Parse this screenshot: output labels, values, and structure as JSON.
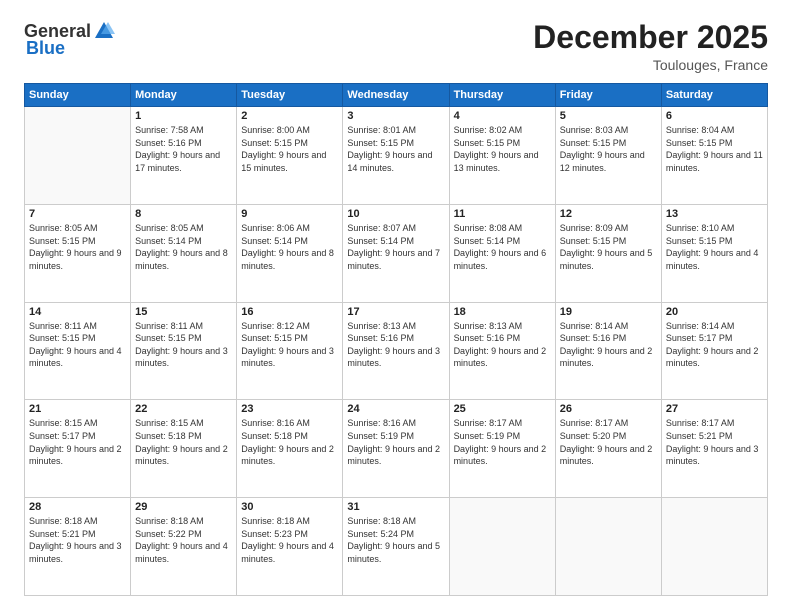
{
  "logo": {
    "general": "General",
    "blue": "Blue"
  },
  "title": "December 2025",
  "subtitle": "Toulouges, France",
  "days_header": [
    "Sunday",
    "Monday",
    "Tuesday",
    "Wednesday",
    "Thursday",
    "Friday",
    "Saturday"
  ],
  "weeks": [
    [
      {
        "day": "",
        "sunrise": "",
        "sunset": "",
        "daylight": ""
      },
      {
        "day": "1",
        "sunrise": "Sunrise: 7:58 AM",
        "sunset": "Sunset: 5:16 PM",
        "daylight": "Daylight: 9 hours and 17 minutes."
      },
      {
        "day": "2",
        "sunrise": "Sunrise: 8:00 AM",
        "sunset": "Sunset: 5:15 PM",
        "daylight": "Daylight: 9 hours and 15 minutes."
      },
      {
        "day": "3",
        "sunrise": "Sunrise: 8:01 AM",
        "sunset": "Sunset: 5:15 PM",
        "daylight": "Daylight: 9 hours and 14 minutes."
      },
      {
        "day": "4",
        "sunrise": "Sunrise: 8:02 AM",
        "sunset": "Sunset: 5:15 PM",
        "daylight": "Daylight: 9 hours and 13 minutes."
      },
      {
        "day": "5",
        "sunrise": "Sunrise: 8:03 AM",
        "sunset": "Sunset: 5:15 PM",
        "daylight": "Daylight: 9 hours and 12 minutes."
      },
      {
        "day": "6",
        "sunrise": "Sunrise: 8:04 AM",
        "sunset": "Sunset: 5:15 PM",
        "daylight": "Daylight: 9 hours and 11 minutes."
      }
    ],
    [
      {
        "day": "7",
        "sunrise": "Sunrise: 8:05 AM",
        "sunset": "Sunset: 5:15 PM",
        "daylight": "Daylight: 9 hours and 9 minutes."
      },
      {
        "day": "8",
        "sunrise": "Sunrise: 8:05 AM",
        "sunset": "Sunset: 5:14 PM",
        "daylight": "Daylight: 9 hours and 8 minutes."
      },
      {
        "day": "9",
        "sunrise": "Sunrise: 8:06 AM",
        "sunset": "Sunset: 5:14 PM",
        "daylight": "Daylight: 9 hours and 8 minutes."
      },
      {
        "day": "10",
        "sunrise": "Sunrise: 8:07 AM",
        "sunset": "Sunset: 5:14 PM",
        "daylight": "Daylight: 9 hours and 7 minutes."
      },
      {
        "day": "11",
        "sunrise": "Sunrise: 8:08 AM",
        "sunset": "Sunset: 5:14 PM",
        "daylight": "Daylight: 9 hours and 6 minutes."
      },
      {
        "day": "12",
        "sunrise": "Sunrise: 8:09 AM",
        "sunset": "Sunset: 5:15 PM",
        "daylight": "Daylight: 9 hours and 5 minutes."
      },
      {
        "day": "13",
        "sunrise": "Sunrise: 8:10 AM",
        "sunset": "Sunset: 5:15 PM",
        "daylight": "Daylight: 9 hours and 4 minutes."
      }
    ],
    [
      {
        "day": "14",
        "sunrise": "Sunrise: 8:11 AM",
        "sunset": "Sunset: 5:15 PM",
        "daylight": "Daylight: 9 hours and 4 minutes."
      },
      {
        "day": "15",
        "sunrise": "Sunrise: 8:11 AM",
        "sunset": "Sunset: 5:15 PM",
        "daylight": "Daylight: 9 hours and 3 minutes."
      },
      {
        "day": "16",
        "sunrise": "Sunrise: 8:12 AM",
        "sunset": "Sunset: 5:15 PM",
        "daylight": "Daylight: 9 hours and 3 minutes."
      },
      {
        "day": "17",
        "sunrise": "Sunrise: 8:13 AM",
        "sunset": "Sunset: 5:16 PM",
        "daylight": "Daylight: 9 hours and 3 minutes."
      },
      {
        "day": "18",
        "sunrise": "Sunrise: 8:13 AM",
        "sunset": "Sunset: 5:16 PM",
        "daylight": "Daylight: 9 hours and 2 minutes."
      },
      {
        "day": "19",
        "sunrise": "Sunrise: 8:14 AM",
        "sunset": "Sunset: 5:16 PM",
        "daylight": "Daylight: 9 hours and 2 minutes."
      },
      {
        "day": "20",
        "sunrise": "Sunrise: 8:14 AM",
        "sunset": "Sunset: 5:17 PM",
        "daylight": "Daylight: 9 hours and 2 minutes."
      }
    ],
    [
      {
        "day": "21",
        "sunrise": "Sunrise: 8:15 AM",
        "sunset": "Sunset: 5:17 PM",
        "daylight": "Daylight: 9 hours and 2 minutes."
      },
      {
        "day": "22",
        "sunrise": "Sunrise: 8:15 AM",
        "sunset": "Sunset: 5:18 PM",
        "daylight": "Daylight: 9 hours and 2 minutes."
      },
      {
        "day": "23",
        "sunrise": "Sunrise: 8:16 AM",
        "sunset": "Sunset: 5:18 PM",
        "daylight": "Daylight: 9 hours and 2 minutes."
      },
      {
        "day": "24",
        "sunrise": "Sunrise: 8:16 AM",
        "sunset": "Sunset: 5:19 PM",
        "daylight": "Daylight: 9 hours and 2 minutes."
      },
      {
        "day": "25",
        "sunrise": "Sunrise: 8:17 AM",
        "sunset": "Sunset: 5:19 PM",
        "daylight": "Daylight: 9 hours and 2 minutes."
      },
      {
        "day": "26",
        "sunrise": "Sunrise: 8:17 AM",
        "sunset": "Sunset: 5:20 PM",
        "daylight": "Daylight: 9 hours and 2 minutes."
      },
      {
        "day": "27",
        "sunrise": "Sunrise: 8:17 AM",
        "sunset": "Sunset: 5:21 PM",
        "daylight": "Daylight: 9 hours and 3 minutes."
      }
    ],
    [
      {
        "day": "28",
        "sunrise": "Sunrise: 8:18 AM",
        "sunset": "Sunset: 5:21 PM",
        "daylight": "Daylight: 9 hours and 3 minutes."
      },
      {
        "day": "29",
        "sunrise": "Sunrise: 8:18 AM",
        "sunset": "Sunset: 5:22 PM",
        "daylight": "Daylight: 9 hours and 4 minutes."
      },
      {
        "day": "30",
        "sunrise": "Sunrise: 8:18 AM",
        "sunset": "Sunset: 5:23 PM",
        "daylight": "Daylight: 9 hours and 4 minutes."
      },
      {
        "day": "31",
        "sunrise": "Sunrise: 8:18 AM",
        "sunset": "Sunset: 5:24 PM",
        "daylight": "Daylight: 9 hours and 5 minutes."
      },
      {
        "day": "",
        "sunrise": "",
        "sunset": "",
        "daylight": ""
      },
      {
        "day": "",
        "sunrise": "",
        "sunset": "",
        "daylight": ""
      },
      {
        "day": "",
        "sunrise": "",
        "sunset": "",
        "daylight": ""
      }
    ]
  ]
}
